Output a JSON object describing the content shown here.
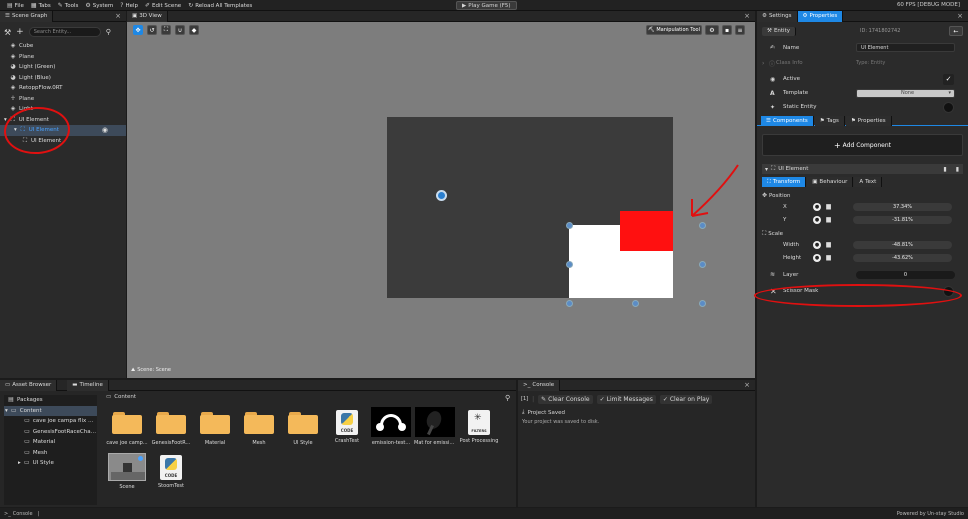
{
  "menu": {
    "file": "File",
    "tabs": "Tabs",
    "tools": "Tools",
    "system": "System",
    "help": "Help",
    "edit_scene": "Edit Scene",
    "reload": "Reload All Templates",
    "play": "Play Game (F5)",
    "fps": "60 FPS [DEBUG MODE]"
  },
  "scene_graph": {
    "title": "Scene Graph",
    "search_placeholder": "Search Entity...",
    "items": [
      {
        "label": "Cube",
        "icon": "cube"
      },
      {
        "label": "Plane",
        "icon": "cube"
      },
      {
        "label": "Light (Green)",
        "icon": "bulb"
      },
      {
        "label": "Light (Blue)",
        "icon": "bulb"
      },
      {
        "label": "RetoppFlow.0RT",
        "icon": "cube"
      },
      {
        "label": "Plane",
        "icon": "figure"
      },
      {
        "label": "Light",
        "icon": "cube"
      },
      {
        "label": "UI Element",
        "icon": "ui"
      },
      {
        "label": "UI Element",
        "icon": "ui"
      },
      {
        "label": "UI Element",
        "icon": "ui"
      }
    ]
  },
  "view": {
    "title": "3D View",
    "manip": "Manipulation Tool",
    "scene_label": "Scene: Scene"
  },
  "settings": {
    "tab_settings": "Settings",
    "tab_properties": "Properties",
    "entity_tab": "Entity",
    "entity_id": "ID: 1741802742",
    "name_label": "Name",
    "name_value": "UI Element",
    "class_info": "Class Info",
    "type_value": "Type: Entity",
    "active_label": "Active",
    "template_label": "Template",
    "template_value": "None",
    "static_label": "Static Entity",
    "tab_components": "Components",
    "tab_tags": "Tags",
    "tab_props": "Properties",
    "add_component": "Add Component",
    "component_name": "UI Element",
    "sub_transform": "Transform",
    "sub_behaviour": "Behaviour",
    "sub_text": "Text",
    "position_label": "Position",
    "x_label": "X",
    "x_value": "37.34%",
    "y_label": "Y",
    "y_value": "-31.81%",
    "scale_label": "Scale",
    "width_label": "Width",
    "width_value": "-48.81%",
    "height_label": "Height",
    "height_value": "-43.62%",
    "layer_label": "Layer",
    "layer_value": "0",
    "scissor_label": "Scissor Mask"
  },
  "asset_browser": {
    "tab1": "Asset Browser",
    "tab2": "Timeline",
    "packages": "Packages",
    "content": "Content",
    "tree": [
      "cave joe campa flix with &...",
      "GenesisFootRaceCharacter",
      "Material",
      "Mesh",
      "UI Style"
    ],
    "path": "Content",
    "assets": [
      {
        "label": "cave joe camp...",
        "kind": "folder"
      },
      {
        "label": "GenesisFootR...",
        "kind": "folder"
      },
      {
        "label": "Material",
        "kind": "folder"
      },
      {
        "label": "Mesh",
        "kind": "folder"
      },
      {
        "label": "UI Style",
        "kind": "folder"
      },
      {
        "label": "CrashTest",
        "kind": "code"
      },
      {
        "label": "emission-test...",
        "kind": "img1"
      },
      {
        "label": "Mat for emissio...",
        "kind": "img2"
      },
      {
        "label": "Post Processing",
        "kind": "filters"
      },
      {
        "label": "Scene",
        "kind": "scene"
      },
      {
        "label": "StoomTest",
        "kind": "code"
      }
    ]
  },
  "console": {
    "title": "Console",
    "count": "[1]",
    "clear": "Clear Console",
    "limit": "Limit Messages",
    "clear_on_play": "Clear on Play",
    "msg_title": "Project Saved",
    "msg_body": "Your project was saved to disk."
  },
  "status": {
    "left": "Console",
    "right": "Powered by Un-stay Studio"
  },
  "colors": {
    "accent": "#1e88e5",
    "red": "#ff1010",
    "handle": "#5b8cc6"
  }
}
